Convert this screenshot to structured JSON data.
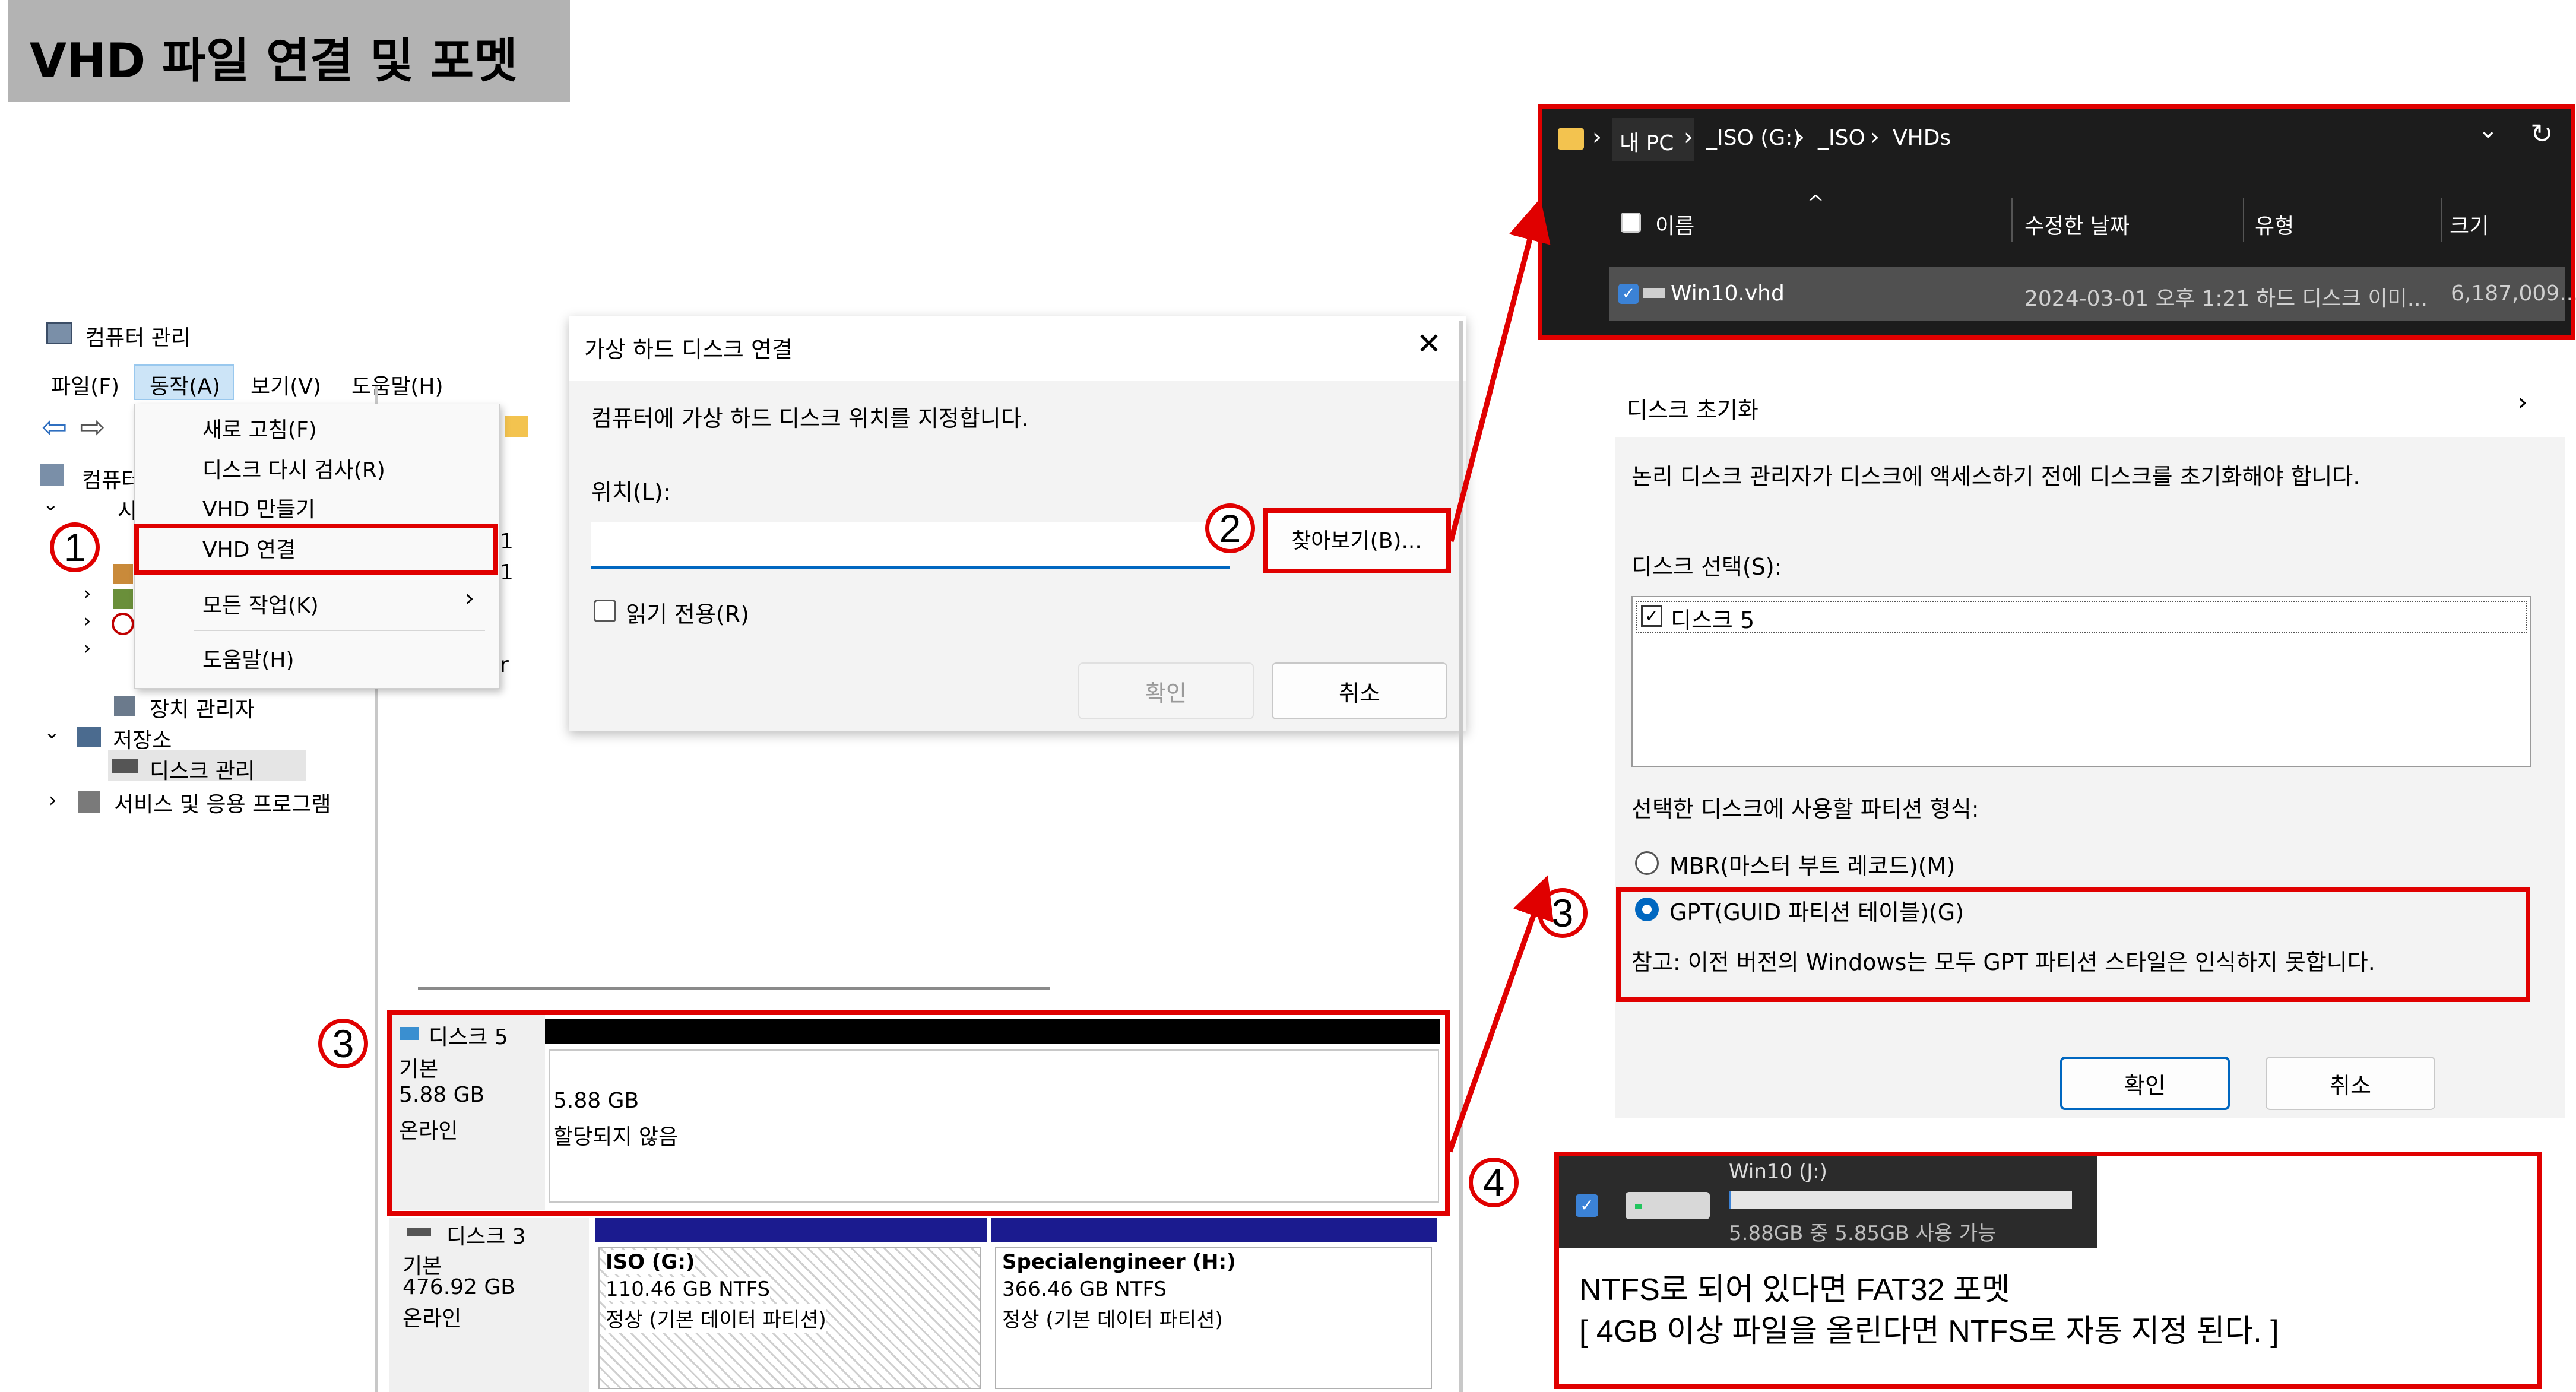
{
  "title": "VHD 파일 연결 및 포멧",
  "badges": [
    "1",
    "2",
    "3",
    "3",
    "3",
    "4"
  ],
  "computer_management": {
    "window_title": "컴퓨터 관리",
    "menu": [
      "파일(F)",
      "동작(A)",
      "보기(V)",
      "도움말(H)"
    ],
    "tree_partial_1": "컴퓨터",
    "tree_partial_2": "시",
    "tree_partial_nums": [
      "1",
      "1"
    ],
    "tree_partial_r": "r",
    "device_manager": "장치 관리자",
    "storage": "저장소",
    "disk_management": "디스크 관리",
    "services": "서비스 및 응용 프로그램"
  },
  "action_menu": {
    "items": [
      "새로 고침(F)",
      "디스크 다시 검사(R)",
      "VHD 만들기",
      "VHD 연결",
      "모든 작업(K)",
      "도움말(H)"
    ],
    "submenu_arrow": "›"
  },
  "attach_dialog": {
    "title": "가상 하드 디스크 연결",
    "close": "✕",
    "description": "컴퓨터에 가상 하드 디스크 위치를 지정합니다.",
    "location_label": "위치(L):",
    "location_value": "",
    "browse": "찾아보기(B)...",
    "readonly": "읽기 전용(R)",
    "ok": "확인",
    "cancel": "취소"
  },
  "disk5": {
    "name": "디스크 5",
    "type": "기본",
    "size": "5.88 GB",
    "status": "온라인",
    "part_size": "5.88 GB",
    "part_status": "할당되지 않음"
  },
  "disk3": {
    "name": "디스크 3",
    "type": "기본",
    "size": "476.92 GB",
    "status": "온라인",
    "p1_name": "ISO  (G:)",
    "p1_size": "110.46 GB NTFS",
    "p1_status": "정상 (기본 데이터 파티션)",
    "p2_name": "Specialengineer  (H:)",
    "p2_size": "366.46 GB NTFS",
    "p2_status": "정상 (기본 데이터 파티션)"
  },
  "explorer": {
    "breadcrumb": [
      "내 PC",
      "_ISO (G:)",
      "_ISO",
      "VHDs"
    ],
    "sep": "›",
    "sort_caret": "^",
    "dropdown": "⌄",
    "refresh": "↻",
    "columns": [
      "이름",
      "수정한 날짜",
      "유형",
      "크기"
    ],
    "file": {
      "name": "Win10.vhd",
      "date": "2024-03-01 오후 1:21",
      "type": "하드 디스크 이미...",
      "size": "6,187,009..."
    }
  },
  "init_dialog": {
    "title": "디스크 초기화",
    "chevron": "›",
    "description": "논리 디스크 관리자가 디스크에 액세스하기 전에 디스크를 초기화해야 합니다.",
    "select_label": "디스크 선택(S):",
    "disk_item": "디스크 5",
    "partition_label": "선택한 디스크에 사용할 파티션 형식:",
    "mbr": "MBR(마스터 부트 레코드)(M)",
    "gpt": "GPT(GUID 파티션 테이블)(G)",
    "note": "참고: 이전 버전의 Windows는 모두 GPT 파티션 스타일은 인식하지 못합니다.",
    "ok": "확인",
    "cancel": "취소"
  },
  "drive_tile": {
    "name": "Win10 (J:)",
    "space": "5.88GB 중 5.85GB 사용 가능",
    "used_fraction": 0.005
  },
  "note": {
    "line1": "NTFS로 되어 있다면 FAT32 포멧",
    "line2": "[ 4GB 이상 파일을 올린다면 NTFS로 자동 지정 된다. ]"
  },
  "colors": {
    "red": "#e00000",
    "accent": "#0067c0",
    "dark": "#1c1c1c"
  }
}
